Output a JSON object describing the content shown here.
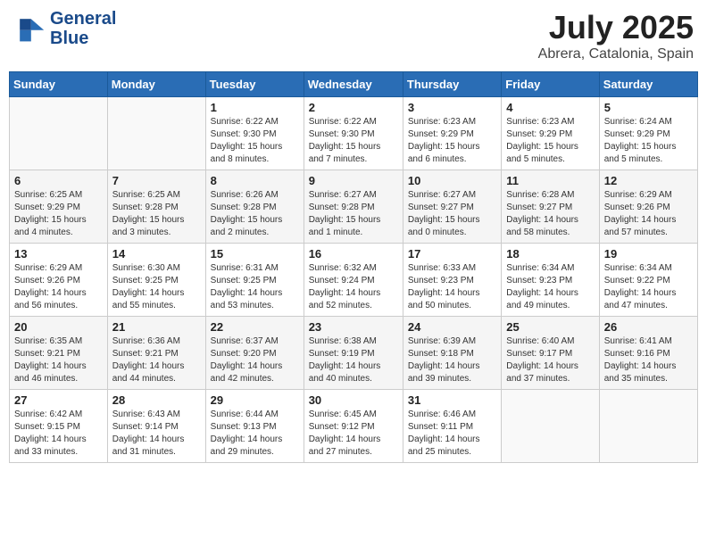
{
  "header": {
    "logo_line1": "General",
    "logo_line2": "Blue",
    "month": "July 2025",
    "location": "Abrera, Catalonia, Spain"
  },
  "days_of_week": [
    "Sunday",
    "Monday",
    "Tuesday",
    "Wednesday",
    "Thursday",
    "Friday",
    "Saturday"
  ],
  "weeks": [
    [
      {
        "day": "",
        "info": ""
      },
      {
        "day": "",
        "info": ""
      },
      {
        "day": "1",
        "info": "Sunrise: 6:22 AM\nSunset: 9:30 PM\nDaylight: 15 hours\nand 8 minutes."
      },
      {
        "day": "2",
        "info": "Sunrise: 6:22 AM\nSunset: 9:30 PM\nDaylight: 15 hours\nand 7 minutes."
      },
      {
        "day": "3",
        "info": "Sunrise: 6:23 AM\nSunset: 9:29 PM\nDaylight: 15 hours\nand 6 minutes."
      },
      {
        "day": "4",
        "info": "Sunrise: 6:23 AM\nSunset: 9:29 PM\nDaylight: 15 hours\nand 5 minutes."
      },
      {
        "day": "5",
        "info": "Sunrise: 6:24 AM\nSunset: 9:29 PM\nDaylight: 15 hours\nand 5 minutes."
      }
    ],
    [
      {
        "day": "6",
        "info": "Sunrise: 6:25 AM\nSunset: 9:29 PM\nDaylight: 15 hours\nand 4 minutes."
      },
      {
        "day": "7",
        "info": "Sunrise: 6:25 AM\nSunset: 9:28 PM\nDaylight: 15 hours\nand 3 minutes."
      },
      {
        "day": "8",
        "info": "Sunrise: 6:26 AM\nSunset: 9:28 PM\nDaylight: 15 hours\nand 2 minutes."
      },
      {
        "day": "9",
        "info": "Sunrise: 6:27 AM\nSunset: 9:28 PM\nDaylight: 15 hours\nand 1 minute."
      },
      {
        "day": "10",
        "info": "Sunrise: 6:27 AM\nSunset: 9:27 PM\nDaylight: 15 hours\nand 0 minutes."
      },
      {
        "day": "11",
        "info": "Sunrise: 6:28 AM\nSunset: 9:27 PM\nDaylight: 14 hours\nand 58 minutes."
      },
      {
        "day": "12",
        "info": "Sunrise: 6:29 AM\nSunset: 9:26 PM\nDaylight: 14 hours\nand 57 minutes."
      }
    ],
    [
      {
        "day": "13",
        "info": "Sunrise: 6:29 AM\nSunset: 9:26 PM\nDaylight: 14 hours\nand 56 minutes."
      },
      {
        "day": "14",
        "info": "Sunrise: 6:30 AM\nSunset: 9:25 PM\nDaylight: 14 hours\nand 55 minutes."
      },
      {
        "day": "15",
        "info": "Sunrise: 6:31 AM\nSunset: 9:25 PM\nDaylight: 14 hours\nand 53 minutes."
      },
      {
        "day": "16",
        "info": "Sunrise: 6:32 AM\nSunset: 9:24 PM\nDaylight: 14 hours\nand 52 minutes."
      },
      {
        "day": "17",
        "info": "Sunrise: 6:33 AM\nSunset: 9:23 PM\nDaylight: 14 hours\nand 50 minutes."
      },
      {
        "day": "18",
        "info": "Sunrise: 6:34 AM\nSunset: 9:23 PM\nDaylight: 14 hours\nand 49 minutes."
      },
      {
        "day": "19",
        "info": "Sunrise: 6:34 AM\nSunset: 9:22 PM\nDaylight: 14 hours\nand 47 minutes."
      }
    ],
    [
      {
        "day": "20",
        "info": "Sunrise: 6:35 AM\nSunset: 9:21 PM\nDaylight: 14 hours\nand 46 minutes."
      },
      {
        "day": "21",
        "info": "Sunrise: 6:36 AM\nSunset: 9:21 PM\nDaylight: 14 hours\nand 44 minutes."
      },
      {
        "day": "22",
        "info": "Sunrise: 6:37 AM\nSunset: 9:20 PM\nDaylight: 14 hours\nand 42 minutes."
      },
      {
        "day": "23",
        "info": "Sunrise: 6:38 AM\nSunset: 9:19 PM\nDaylight: 14 hours\nand 40 minutes."
      },
      {
        "day": "24",
        "info": "Sunrise: 6:39 AM\nSunset: 9:18 PM\nDaylight: 14 hours\nand 39 minutes."
      },
      {
        "day": "25",
        "info": "Sunrise: 6:40 AM\nSunset: 9:17 PM\nDaylight: 14 hours\nand 37 minutes."
      },
      {
        "day": "26",
        "info": "Sunrise: 6:41 AM\nSunset: 9:16 PM\nDaylight: 14 hours\nand 35 minutes."
      }
    ],
    [
      {
        "day": "27",
        "info": "Sunrise: 6:42 AM\nSunset: 9:15 PM\nDaylight: 14 hours\nand 33 minutes."
      },
      {
        "day": "28",
        "info": "Sunrise: 6:43 AM\nSunset: 9:14 PM\nDaylight: 14 hours\nand 31 minutes."
      },
      {
        "day": "29",
        "info": "Sunrise: 6:44 AM\nSunset: 9:13 PM\nDaylight: 14 hours\nand 29 minutes."
      },
      {
        "day": "30",
        "info": "Sunrise: 6:45 AM\nSunset: 9:12 PM\nDaylight: 14 hours\nand 27 minutes."
      },
      {
        "day": "31",
        "info": "Sunrise: 6:46 AM\nSunset: 9:11 PM\nDaylight: 14 hours\nand 25 minutes."
      },
      {
        "day": "",
        "info": ""
      },
      {
        "day": "",
        "info": ""
      }
    ]
  ]
}
